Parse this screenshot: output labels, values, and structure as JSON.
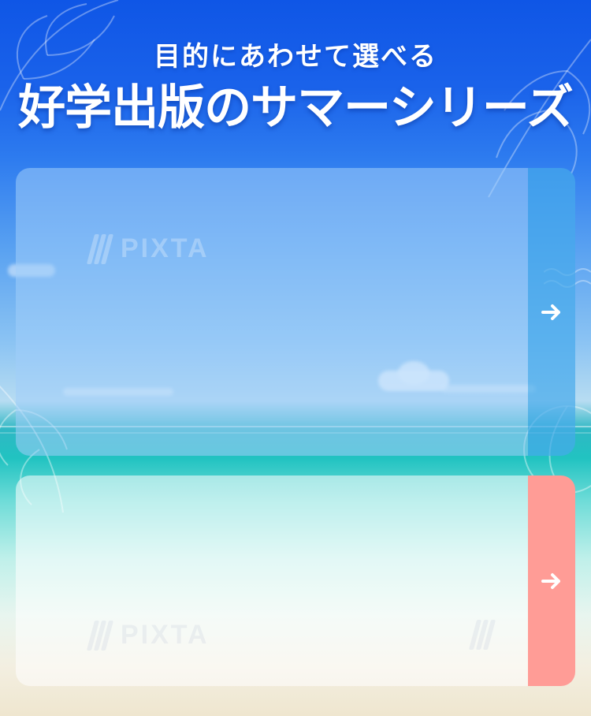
{
  "header": {
    "subtitle": "目的にあわせて選べる",
    "title": "好学出版のサマーシリーズ"
  },
  "cards": [
    {
      "arrow_icon": "arrow-right-icon",
      "tab_color": "#46aaeb"
    },
    {
      "arrow_icon": "arrow-right-icon",
      "tab_color": "#ff9c96"
    }
  ],
  "watermark": {
    "text": "PIXTA"
  },
  "colors": {
    "sky_top": "#0f56e6",
    "sea": "#21c3c1",
    "sand": "#efe6cf"
  }
}
